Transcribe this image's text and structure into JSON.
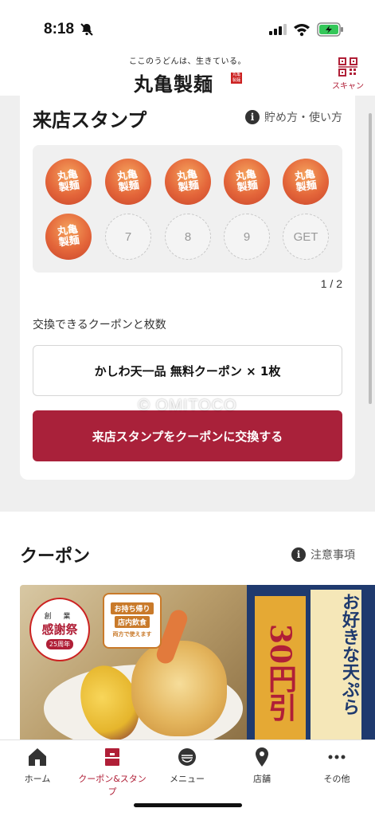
{
  "status_bar": {
    "time": "8:18"
  },
  "header": {
    "tagline": "ここのうどんは、生きている。",
    "logo_text": "丸亀製麺",
    "logo_seal": "丸亀製麺",
    "scan_label": "スキャン"
  },
  "stamp_card": {
    "title": "来店スタンプ",
    "info_link": "貯め方・使い方",
    "stamp_glyph": "丸亀製麺",
    "empty_stamps": [
      "7",
      "8",
      "9",
      "GET"
    ],
    "page_indicator": "1 / 2",
    "exchange_label": "交換できるクーポンと枚数",
    "coupon_item": "かしわ天一品 無料クーポン × 1枚",
    "exchange_button": "来店スタンプをクーポンに交換する"
  },
  "watermark": "© OMITOCO",
  "coupon_section": {
    "title": "クーポン",
    "notes_link": "注意事項",
    "banner": {
      "badge_top": "創 業",
      "badge_main": "感謝祭",
      "badge_sub": "25周年",
      "takeout_1": "お持ち帰り",
      "takeout_2": "店内飲食",
      "takeout_3": "両方で使えます",
      "price": "30円引",
      "headline": "お好きな天ぷら"
    }
  },
  "nav": {
    "home": "ホーム",
    "coupon_stamp": "クーポン&スタンプ",
    "menu": "メニュー",
    "stores": "店舗",
    "other": "その他"
  },
  "colors": {
    "accent": "#a9213a",
    "stamp_orange": "#e4663a"
  }
}
